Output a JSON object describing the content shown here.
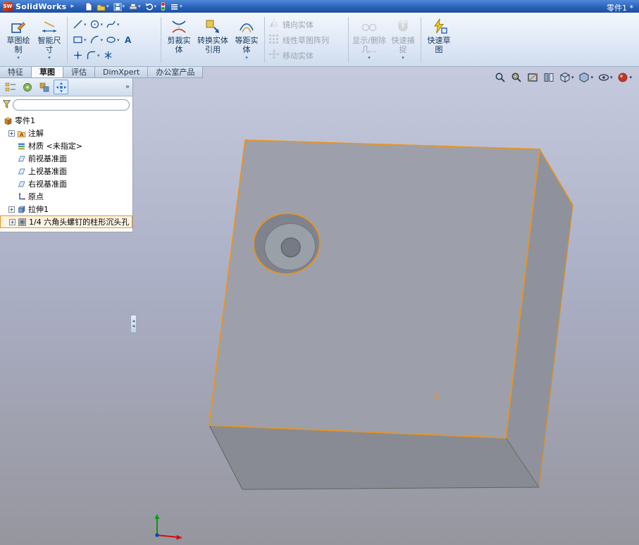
{
  "titlebar": {
    "app_abbr": "SW",
    "app_name": "SolidWorks",
    "document_title": "零件1 *",
    "quick_icons": [
      "new-document-icon",
      "open-icon",
      "save-icon",
      "print-icon",
      "undo-icon",
      "rebuild-icon",
      "options-icon"
    ]
  },
  "ribbon": {
    "sketch_button": "草图绘制",
    "smart_dimension_button": "智能尺寸",
    "trim_button": "剪裁实体",
    "convert_button": "转换实体引用",
    "offset_button": "等距实体",
    "mirror_button": "镜向实体",
    "linear_pattern_button": "线性草图阵列",
    "move_button": "移动实体",
    "display_delete_button": "显示/删除几...",
    "quick_snap_button": "快速捕捉",
    "rapid_sketch_button": "快速草图",
    "tool_icons": [
      "line-icon",
      "circle-icon",
      "spline-icon",
      "rectangle-icon",
      "arc-icon",
      "ellipse-icon",
      "text-icon",
      "point-icon",
      "fillet-icon",
      "asterisk-icon"
    ]
  },
  "tabs": {
    "features": "特征",
    "sketch": "草图",
    "evaluate": "评估",
    "dimxpert": "DimXpert",
    "office": "办公室产品"
  },
  "feature_tree": {
    "root_label": "零件1",
    "filter_value": "",
    "items": [
      {
        "label": "注解",
        "expandable": true
      },
      {
        "label": "材质 <未指定>",
        "expandable": false
      },
      {
        "label": "前视基准面",
        "expandable": false
      },
      {
        "label": "上视基准面",
        "expandable": false
      },
      {
        "label": "右视基准面",
        "expandable": false
      },
      {
        "label": "原点",
        "expandable": false
      },
      {
        "label": "拉伸1",
        "expandable": true
      },
      {
        "label": "1/4 六角头螺钉的柱形沉头孔",
        "expandable": true,
        "selected": true
      }
    ]
  },
  "view_toolbar_icons": [
    "zoom-fit-icon",
    "zoom-area-icon",
    "section-view-icon",
    "view-settings-icon",
    "view-orientation-icon",
    "display-style-icon",
    "hide-show-icon",
    "appearance-icon"
  ],
  "icons": {
    "caret_down": "▾",
    "menu_arrow": "▸",
    "chevron_expand": "»",
    "splitter_arrow": "◂",
    "plus": "+"
  },
  "colors": {
    "edge_highlight": "#e8941f",
    "top_face": "#9da0aa",
    "right_face": "#8f929c",
    "front_face": "#888b93",
    "counterbore_wall": "#7f838d",
    "counterbore_floor": "#9aa0a8",
    "hole": "#767a84",
    "viewport_top": "#c6cade",
    "viewport_bottom": "#96969e"
  }
}
